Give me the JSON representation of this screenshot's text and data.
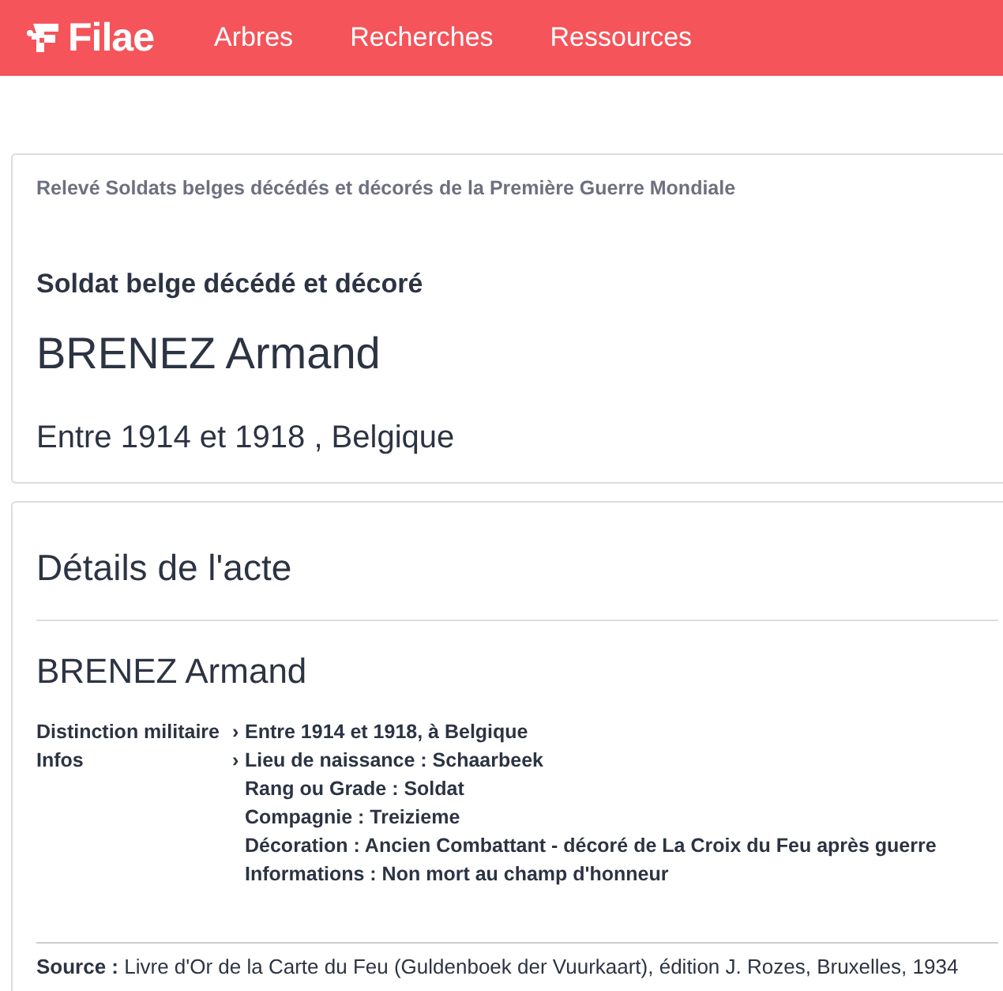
{
  "header": {
    "logo": "Filae",
    "nav": [
      {
        "label": "Arbres"
      },
      {
        "label": "Recherches"
      },
      {
        "label": "Ressources"
      }
    ]
  },
  "record": {
    "collection": "Relevé Soldats belges décédés et décorés de la Première Guerre Mondiale",
    "type": "Soldat belge décédé et décoré",
    "name": "BRENEZ Armand",
    "summary": "Entre 1914 et 1918 , Belgique"
  },
  "details": {
    "title": "Détails de l'acte",
    "name": "BRENEZ Armand",
    "marker": "›",
    "rows": [
      {
        "label": "Distinction militaire",
        "values": [
          "Entre 1914 et 1918, à Belgique"
        ]
      },
      {
        "label": "Infos",
        "values": [
          "Lieu de naissance : Schaarbeek",
          "Rang ou Grade : Soldat",
          "Compagnie : Treizieme",
          "Décoration : Ancien Combattant - décoré de La Croix du Feu après guerre",
          "Informations : Non mort au champ d'honneur"
        ]
      }
    ],
    "source": "**Source :** Livre d'Or de la Carte du Feu (Guldenboek der Vuurkaart), édition J. Rozes, Bruxelles, 1934"
  }
}
